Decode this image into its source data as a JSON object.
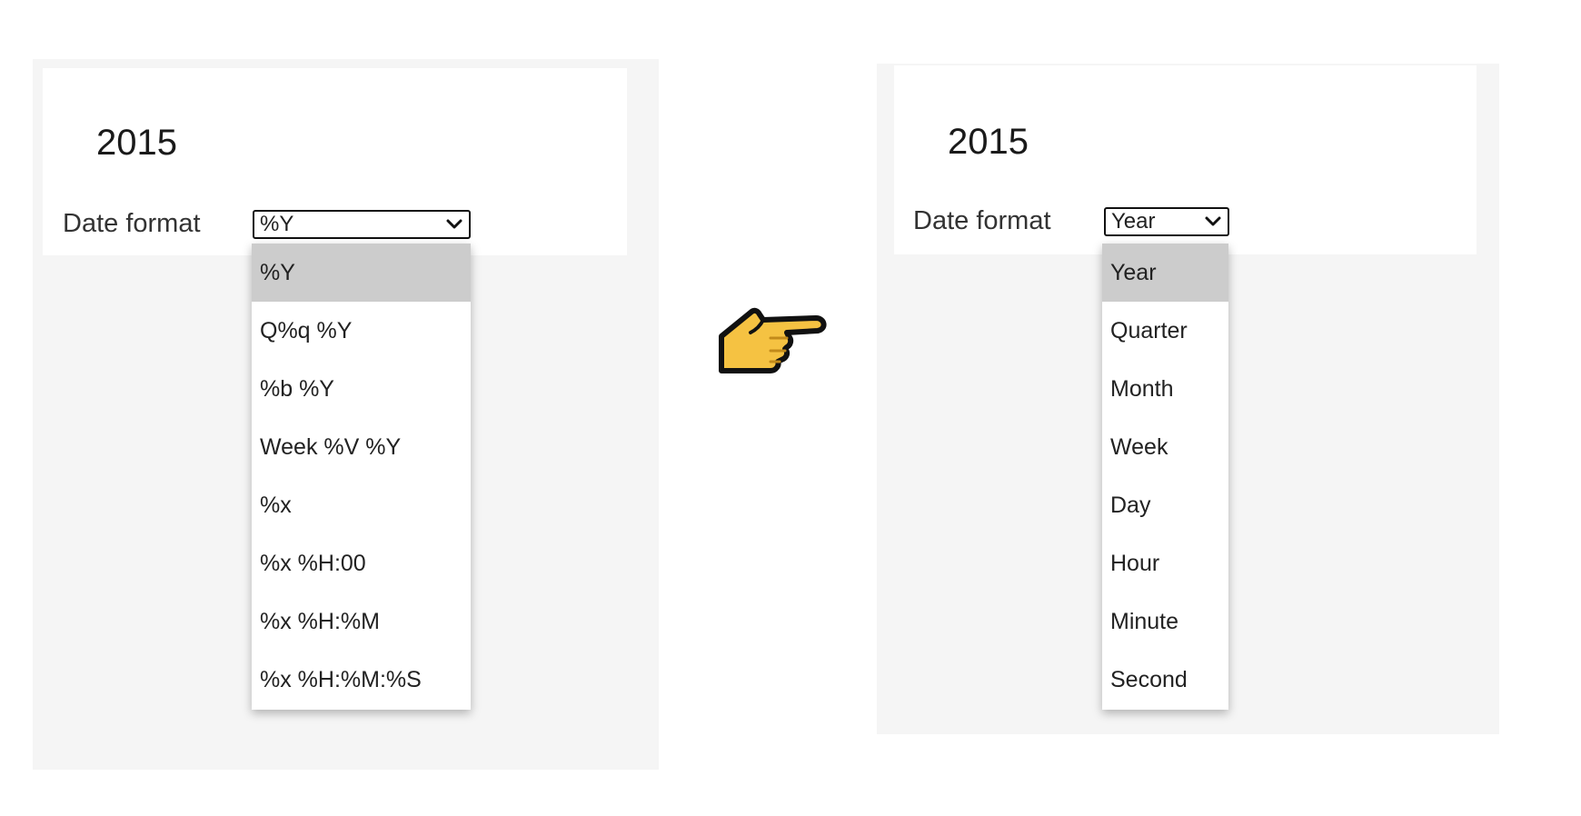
{
  "left_widget": {
    "value": "2015",
    "label": "Date format",
    "selected": "%Y",
    "options": [
      "%Y",
      "Q%q %Y",
      "%b %Y",
      "Week %V %Y",
      "%x",
      "%x %H:00",
      "%x %H:%M",
      "%x %H:%M:%S"
    ]
  },
  "right_widget": {
    "value": "2015",
    "label": "Date format",
    "selected": "Year",
    "options": [
      "Year",
      "Quarter",
      "Month",
      "Week",
      "Day",
      "Hour",
      "Minute",
      "Second"
    ]
  },
  "pointer": {
    "icon": "pointing-hand-right-icon"
  },
  "colors": {
    "panel_bg": "#f5f5f5",
    "highlight": "#cccccc",
    "pointer_fill": "#f5c242",
    "pointer_outline": "#111111"
  }
}
